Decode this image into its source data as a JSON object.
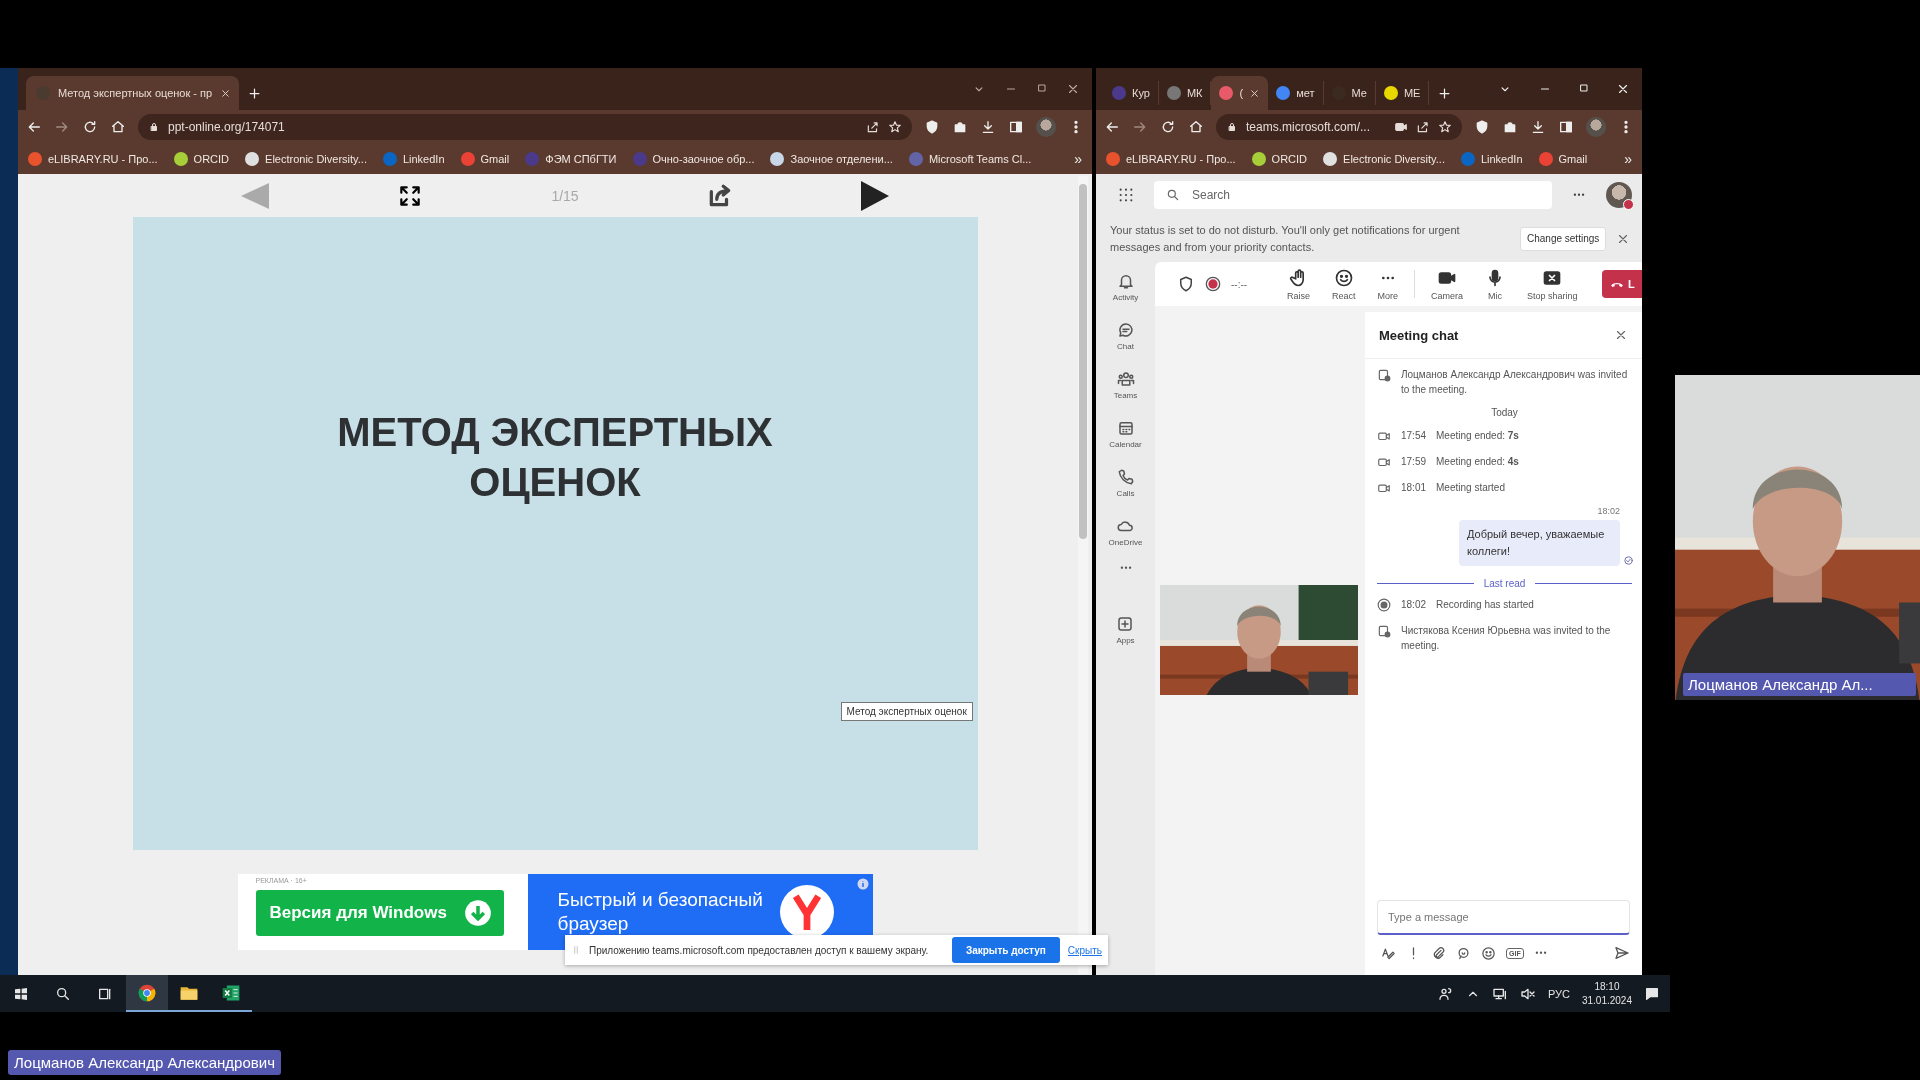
{
  "left_browser": {
    "tab_title": "Метод экспертных оценок - пр",
    "address": "ppt-online.org/174071",
    "bookmarks": [
      {
        "label": "eLIBRARY.RU - Про...",
        "color": "#e8532e"
      },
      {
        "label": "ORCID",
        "color": "#a6ce39"
      },
      {
        "label": "Electronic Diversity...",
        "color": "#e0e0e0"
      },
      {
        "label": "LinkedIn",
        "color": "#0a66c2"
      },
      {
        "label": "Gmail",
        "color": "#ea4335"
      },
      {
        "label": "ФЭМ СПбГТИ",
        "color": "#4b3a8c"
      },
      {
        "label": "Очно-заочное обр...",
        "color": "#4b3a8c"
      },
      {
        "label": "Заочное отделени...",
        "color": "#c9d6e8"
      },
      {
        "label": "Microsoft Teams Cl...",
        "color": "#6264a7"
      }
    ],
    "more_bookmarks": "»",
    "viewer": {
      "page": "1/15",
      "slide_title": "МЕТОД ЭКСПЕРТНЫХ ОЦЕНОК",
      "tooltip": "Метод экспертных оценок"
    },
    "ad": {
      "label": "РЕКЛАМА · 16+",
      "button": "Версия для Windows",
      "headline": "Быстрый и безопасный браузер"
    }
  },
  "share_bar": {
    "message": "Приложению teams.microsoft.com предоставлен доступ к вашему экрану.",
    "stop_button": "Закрыть доступ",
    "hide_link": "Скрыть"
  },
  "teams_browser": {
    "tabs": [
      {
        "label": "Кур",
        "color": "#4b3a8c",
        "selected": false
      },
      {
        "label": "МК",
        "color": "#777777",
        "selected": false
      },
      {
        "label": "(",
        "color": "#e85a6a",
        "selected": true
      },
      {
        "label": "мет",
        "color": "#4285f4",
        "selected": false
      },
      {
        "label": "Ме",
        "color": "#3a2a20",
        "selected": false
      },
      {
        "label": "МЕ",
        "color": "#e8d800",
        "selected": false
      }
    ],
    "address": "teams.microsoft.com/...",
    "bookmarks": [
      {
        "label": "eLIBRARY.RU - Про...",
        "color": "#e8532e"
      },
      {
        "label": "ORCID",
        "color": "#a6ce39"
      },
      {
        "label": "Electronic Diversity...",
        "color": "#e0e0e0"
      },
      {
        "label": "LinkedIn",
        "color": "#0a66c2"
      },
      {
        "label": "Gmail",
        "color": "#ea4335"
      }
    ],
    "more_bookmarks": "»",
    "search": {
      "placeholder": "Search"
    },
    "banner": {
      "text": "Your status is set to do not disturb. You'll only get notifications for urgent messages and from your priority contacts.",
      "button": "Change settings"
    },
    "rail": [
      {
        "kind": "bell",
        "label": "Activity"
      },
      {
        "kind": "chat",
        "label": "Chat"
      },
      {
        "kind": "teams",
        "label": "Teams"
      },
      {
        "kind": "calendar",
        "label": "Calendar"
      },
      {
        "kind": "calls",
        "label": "Calls"
      },
      {
        "kind": "cloud",
        "label": "OneDrive"
      },
      {
        "kind": "more"
      },
      {
        "kind": "apps",
        "label": "Apps"
      }
    ],
    "timer": "--:--",
    "actions": [
      {
        "kind": "hand",
        "label": "Raise"
      },
      {
        "kind": "smile",
        "label": "React"
      },
      {
        "kind": "dots",
        "label": "More"
      },
      {
        "kind": "camera",
        "label": "Camera"
      },
      {
        "kind": "mic",
        "label": "Mic"
      },
      {
        "kind": "stop",
        "label": "Stop sharing"
      }
    ],
    "leave_button": "L",
    "chat": {
      "title": "Meeting chat",
      "items": [
        {
          "kind": "invite",
          "text": "Лоцманов Александр Александрович was invited to the meeting."
        },
        {
          "kind": "date",
          "text": "Today"
        },
        {
          "kind": "event",
          "time": "17:54",
          "text": "Meeting ended: **7s**"
        },
        {
          "kind": "event",
          "time": "17:59",
          "text": "Meeting ended: **4s**"
        },
        {
          "kind": "event",
          "time": "18:01",
          "text": "Meeting started"
        },
        {
          "kind": "message",
          "time": "18:02",
          "text": "Добрый вечер, уважаемые коллеги!"
        },
        {
          "kind": "divider",
          "text": "Last read"
        },
        {
          "kind": "recording",
          "time": "18:02",
          "text": "Recording has started"
        },
        {
          "kind": "invite",
          "text": "Чистякова Ксения Юрьевна was invited to the meeting."
        }
      ],
      "composer": {
        "placeholder": "Type a message",
        "gif": "GIF"
      }
    }
  },
  "taskbar": {
    "apps": [
      {
        "kind": "chrome",
        "active": true
      },
      {
        "kind": "explorer",
        "active": false
      },
      {
        "kind": "excel",
        "active": false
      }
    ],
    "language": "РУС",
    "time": "18:10",
    "date": "31.01.2024"
  },
  "video_name": "Лоцманов Александр Ал...",
  "presenter_name": "Лоцманов Александр Александрович"
}
